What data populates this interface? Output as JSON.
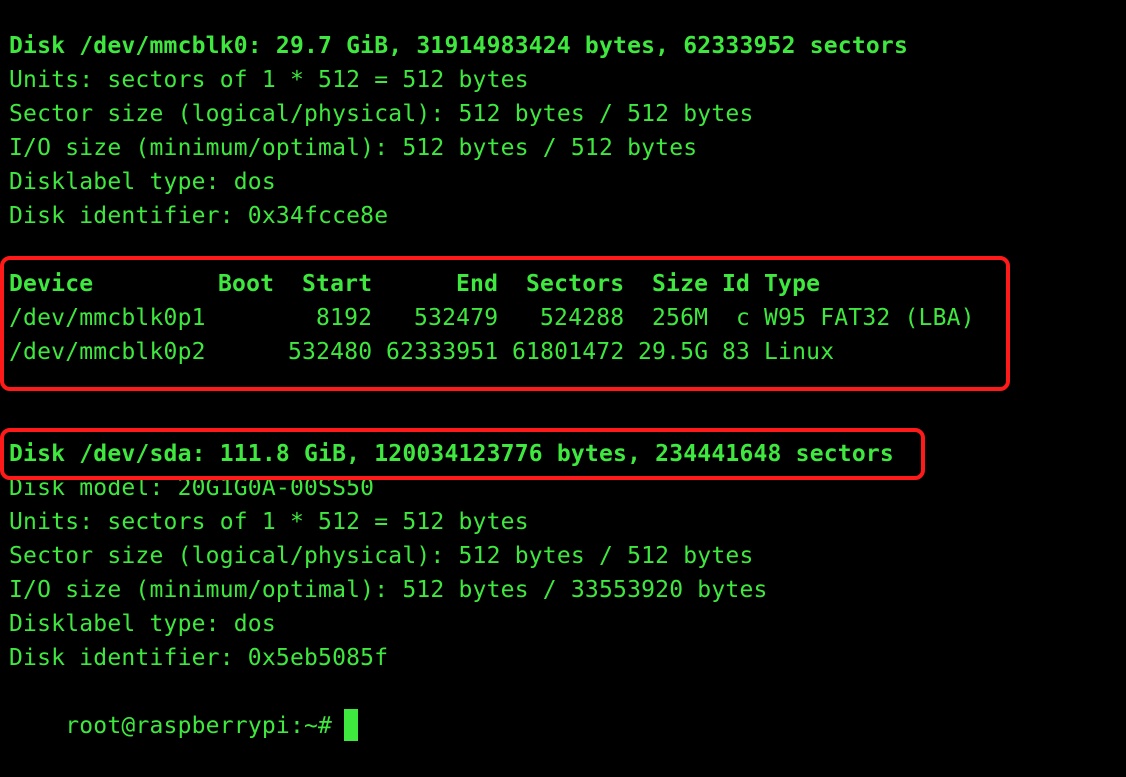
{
  "colors": {
    "background": "#000000",
    "text": "#3fe83f",
    "highlight_box": "#ff1a1a"
  },
  "disk1": {
    "header": "Disk /dev/mmcblk0: 29.7 GiB, 31914983424 bytes, 62333952 sectors",
    "units": "Units: sectors of 1 * 512 = 512 bytes",
    "sector_size": "Sector size (logical/physical): 512 bytes / 512 bytes",
    "io_size": "I/O size (minimum/optimal): 512 bytes / 512 bytes",
    "disklabel": "Disklabel type: dos",
    "identifier": "Disk identifier: 0x34fcce8e"
  },
  "partition_table": {
    "columns": [
      "Device",
      "Boot",
      "Start",
      "End",
      "Sectors",
      "Size",
      "Id",
      "Type"
    ],
    "rows": [
      {
        "device": "/dev/mmcblk0p1",
        "boot": "",
        "start": "8192",
        "end": "532479",
        "sectors": "524288",
        "size": "256M",
        "id": "c",
        "type": "W95 FAT32 (LBA)"
      },
      {
        "device": "/dev/mmcblk0p2",
        "boot": "",
        "start": "532480",
        "end": "62333951",
        "sectors": "61801472",
        "size": "29.5G",
        "id": "83",
        "type": "Linux"
      }
    ]
  },
  "disk2": {
    "header": "Disk /dev/sda: 111.8 GiB, 120034123776 bytes, 234441648 sectors",
    "model": "Disk model: 20G1G0A-00SS50",
    "units": "Units: sectors of 1 * 512 = 512 bytes",
    "sector_size": "Sector size (logical/physical): 512 bytes / 512 bytes",
    "io_size": "I/O size (minimum/optimal): 512 bytes / 33553920 bytes",
    "disklabel": "Disklabel type: dos",
    "identifier": "Disk identifier: 0x5eb5085f"
  },
  "prompt": {
    "text": "root@raspberrypi:~#"
  }
}
